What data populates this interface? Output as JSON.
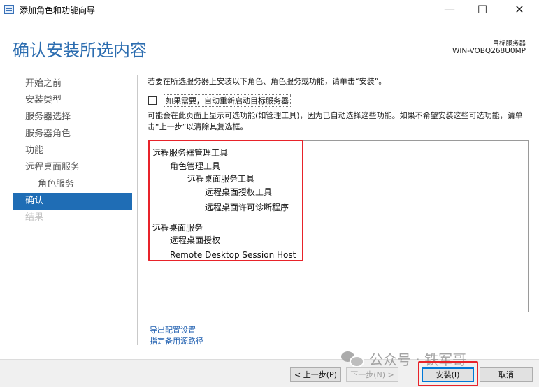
{
  "window": {
    "title": "添加角色和功能向导",
    "controls": {
      "minimize": "—",
      "maximize": "☐",
      "close": "✕"
    }
  },
  "header": {
    "title": "确认安装所选内容",
    "target_label": "目标服务器",
    "target_name": "WIN-VOBQ268U0MP"
  },
  "sidebar": {
    "items": [
      {
        "label": "开始之前",
        "state": "normal"
      },
      {
        "label": "安装类型",
        "state": "normal"
      },
      {
        "label": "服务器选择",
        "state": "normal"
      },
      {
        "label": "服务器角色",
        "state": "normal"
      },
      {
        "label": "功能",
        "state": "normal"
      },
      {
        "label": "远程桌面服务",
        "state": "normal"
      },
      {
        "label": "角色服务",
        "state": "sub"
      },
      {
        "label": "确认",
        "state": "active"
      },
      {
        "label": "结果",
        "state": "disabled"
      }
    ]
  },
  "main": {
    "instruction": "若要在所选服务器上安装以下角色、角色服务或功能，请单击“安装”。",
    "restart_checkbox": {
      "label": "如果需要，自动重新启动目标服务器",
      "checked": false
    },
    "note": "可能会在此页面上显示可选功能(如管理工具)，因为已自动选择这些功能。如果不希望安装这些可选功能，请单击“上一步”以清除其复选框。",
    "features": [
      {
        "label": "远程服务器管理工具",
        "level": 0
      },
      {
        "label": "角色管理工具",
        "level": 1
      },
      {
        "label": "远程桌面服务工具",
        "level": 2
      },
      {
        "label": "远程桌面授权工具",
        "level": 3
      },
      {
        "label": "远程桌面许可诊断程序",
        "level": 3
      },
      {
        "label": "远程桌面服务",
        "level": 0
      },
      {
        "label": "远程桌面授权",
        "level": 1
      },
      {
        "label": "Remote Desktop Session Host",
        "level": 1
      }
    ],
    "links": {
      "export": "导出配置设置",
      "alternate_source": "指定备用源路径"
    }
  },
  "footer": {
    "prev": "< 上一步(P)",
    "next": "下一步(N) >",
    "install": "安装(I)",
    "cancel": "取消"
  },
  "watermark": {
    "text": "公众号 · 铁军哥"
  },
  "colors": {
    "accent": "#1f6db5",
    "highlight": "#e8232a",
    "link": "#1f5fb0"
  }
}
